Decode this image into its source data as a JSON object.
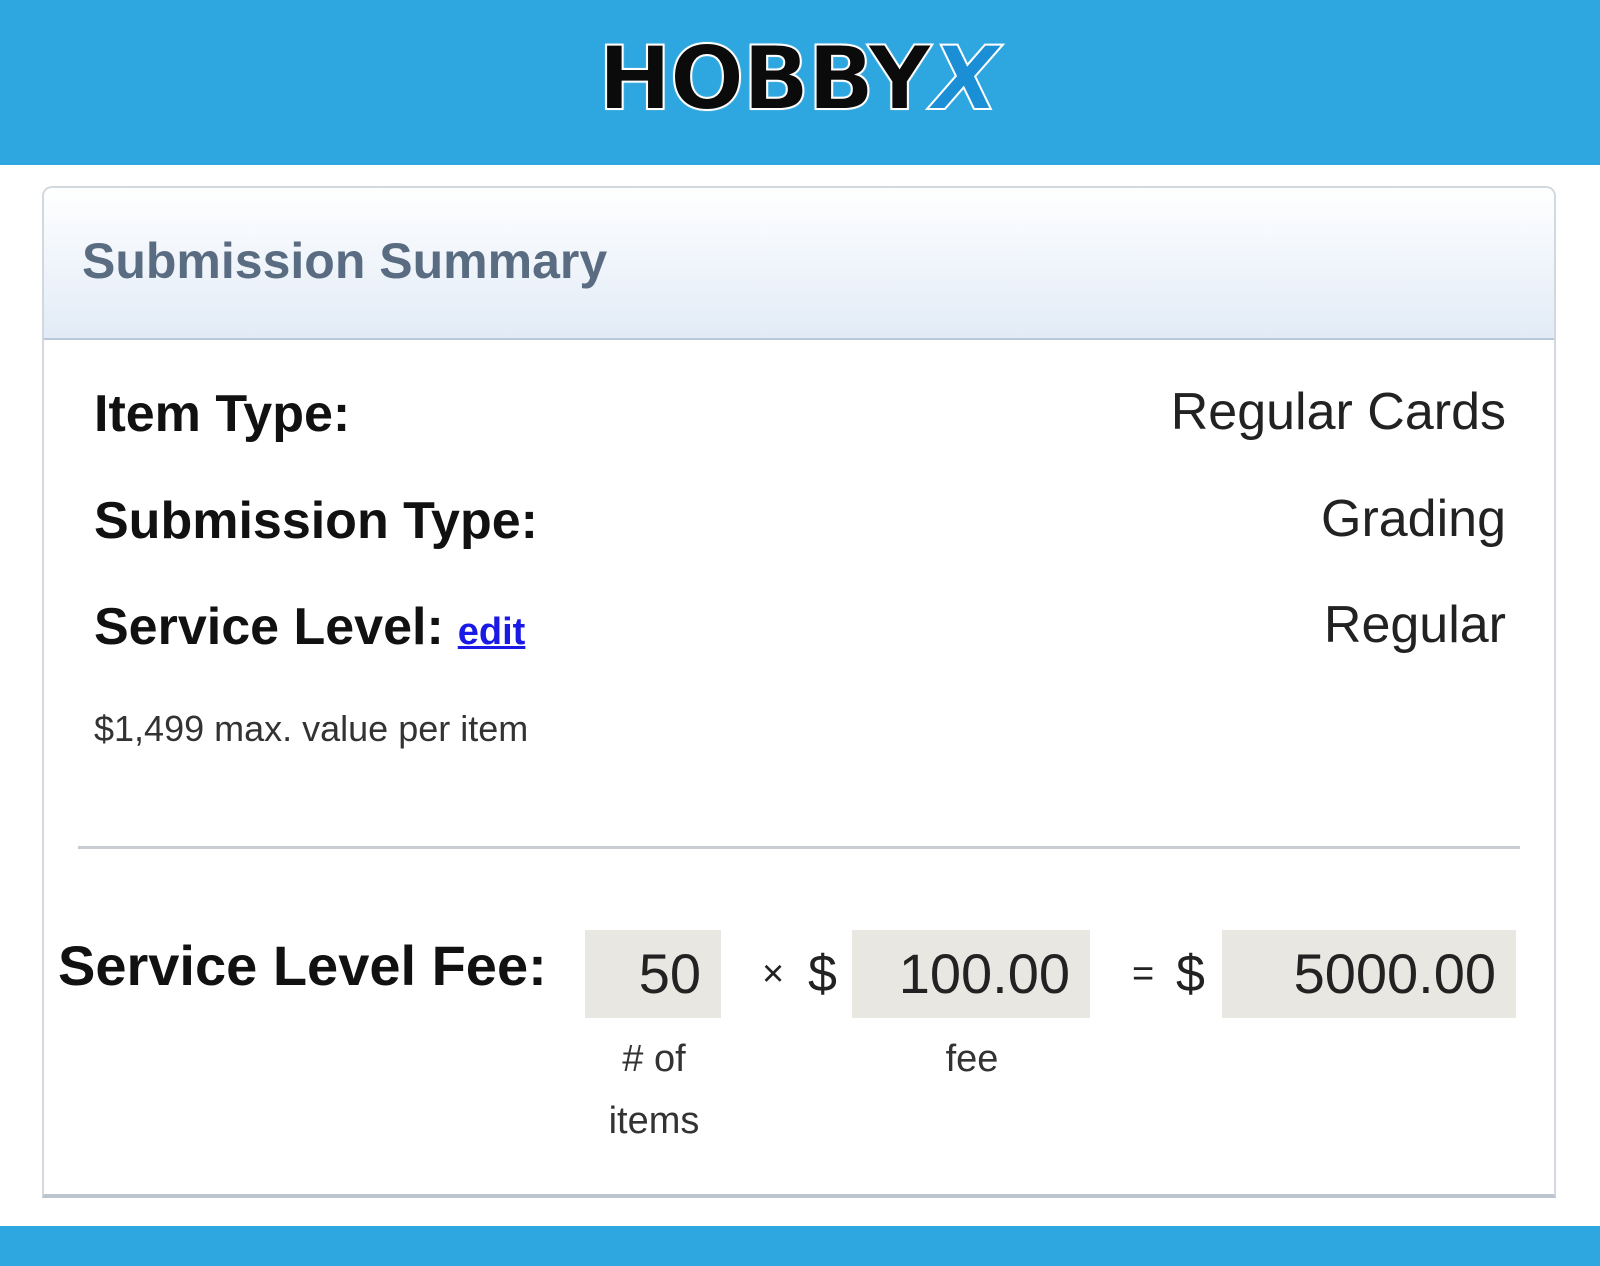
{
  "brand": {
    "logo_main": "HOBBY",
    "logo_accent": "X",
    "accent_color": "#2ea6df"
  },
  "summary": {
    "title": "Submission Summary",
    "rows": [
      {
        "label": "Item Type:",
        "value": "Regular Cards"
      },
      {
        "label": "Submission Type:",
        "value": "Grading"
      },
      {
        "label": "Service Level:",
        "value": "Regular",
        "link": "edit"
      }
    ],
    "note": "$1,499 max. value per item"
  },
  "fee": {
    "label": "Service Level Fee:",
    "items": "50",
    "times": "×",
    "currency": "$",
    "unit_fee": "100.00",
    "equals": "=",
    "total": "5000.00",
    "items_caption_line1": "# of",
    "items_caption_line2": "items",
    "fee_caption": "fee"
  }
}
